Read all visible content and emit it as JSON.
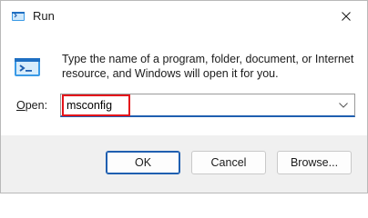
{
  "window": {
    "title": "Run",
    "title_icon": "run-app-icon",
    "close_icon": "close-icon"
  },
  "content": {
    "icon": "run-app-icon",
    "description": "Type the name of a program, folder, document, or Internet resource, and Windows will open it for you.",
    "open_label_accel": "O",
    "open_label_rest": "pen:",
    "open_value": "msconfig",
    "dropdown_icon": "chevron-down-icon",
    "highlight_color": "#e4141b"
  },
  "buttons": {
    "ok_label": "OK",
    "cancel_label": "Cancel",
    "browse_label": "Browse..."
  },
  "colors": {
    "accent": "#1f5fb0",
    "button_strip": "#f0f0f0"
  }
}
